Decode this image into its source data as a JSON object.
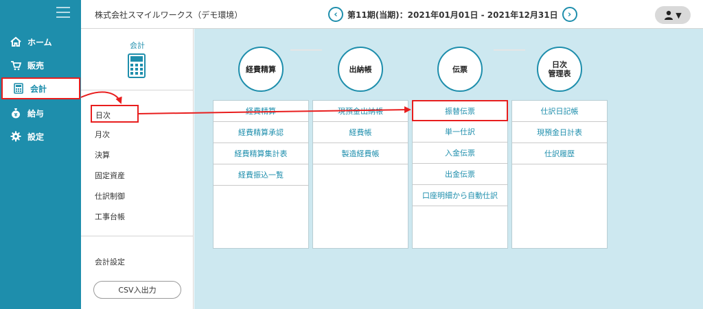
{
  "sidebar": {
    "items": [
      {
        "label": "ホーム",
        "icon": "home-icon"
      },
      {
        "label": "販売",
        "icon": "cart-icon"
      },
      {
        "label": "会計",
        "icon": "calculator-icon"
      },
      {
        "label": "給与",
        "icon": "money-bag-icon"
      },
      {
        "label": "設定",
        "icon": "gear-icon"
      }
    ],
    "active_index": 2
  },
  "header": {
    "company": "株式会社スマイルワークス（デモ環境）",
    "period": "第11期(当期)：2021年01月01日 - 2021年12月31日",
    "prev_glyph": "‹",
    "next_glyph": "›",
    "user_caret": "▼"
  },
  "submenu": {
    "title": "会計",
    "items": [
      "日次",
      "月次",
      "決算",
      "固定資産",
      "仕訳制御",
      "工事台帳"
    ],
    "active_index": 0,
    "settings": "会計設定",
    "csv_button": "CSV入出力"
  },
  "groups": [
    {
      "title": "経費精算",
      "items": [
        "経費精算",
        "経費精算承認",
        "経費精算集計表",
        "経費振込一覧"
      ]
    },
    {
      "title": "出納帳",
      "items": [
        "現預金出納帳",
        "経費帳",
        "製造経費帳"
      ]
    },
    {
      "title": "伝票",
      "items": [
        "振替伝票",
        "単一仕訳",
        "入金伝票",
        "出金伝票",
        "口座明細から自動仕訳"
      ],
      "highlight_index": 0
    },
    {
      "title_line1": "日次",
      "title_line2": "管理表",
      "items": [
        "仕訳日記帳",
        "現預金日計表",
        "仕訳履歴"
      ]
    }
  ],
  "colors": {
    "accent": "#1e8eac",
    "main_bg": "#cde8f0",
    "highlight": "#e81d1d"
  }
}
